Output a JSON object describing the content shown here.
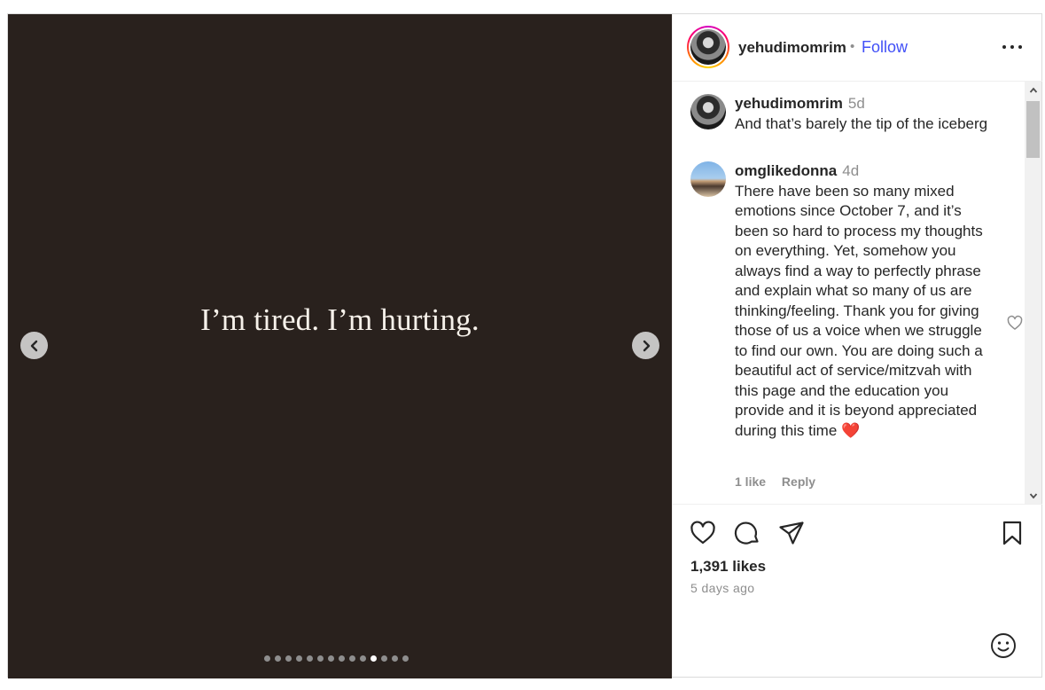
{
  "post": {
    "slide_text": "I’m tired. I’m hurting.",
    "slide_count": 14,
    "active_slide_index": 10,
    "media_background": "#29211d"
  },
  "header": {
    "username": "yehudimomrim",
    "separator": "•",
    "follow_label": "Follow",
    "follow_color": "#4150f7",
    "more_icon": "more-horizontal-icon"
  },
  "comments": [
    {
      "username": "yehudimomrim",
      "time": "5d",
      "text": "And that’s barely the tip of the iceberg"
    },
    {
      "username": "omglikedonna",
      "time": "4d",
      "text": "There have been so many mixed emotions since October 7, and it’s been so hard to process my thoughts on everything. Yet, somehow you always find a way to perfectly phrase and explain what so many of us are thinking/feeling. Thank you for giving those of us a voice when we struggle to find our own. You are doing such a beautiful act of service/mitzvah with this page and the education you provide and it is beyond appreciated during this time",
      "emoji": "❤️",
      "likes_label": "1 like",
      "reply_label": "Reply"
    }
  ],
  "actions": {
    "icons": [
      "heart-icon",
      "comment-icon",
      "share-icon",
      "bookmark-icon"
    ],
    "likes_text": "1,391 likes",
    "posted_text": "5 days ago",
    "emoji_icon": "emoji-icon"
  }
}
